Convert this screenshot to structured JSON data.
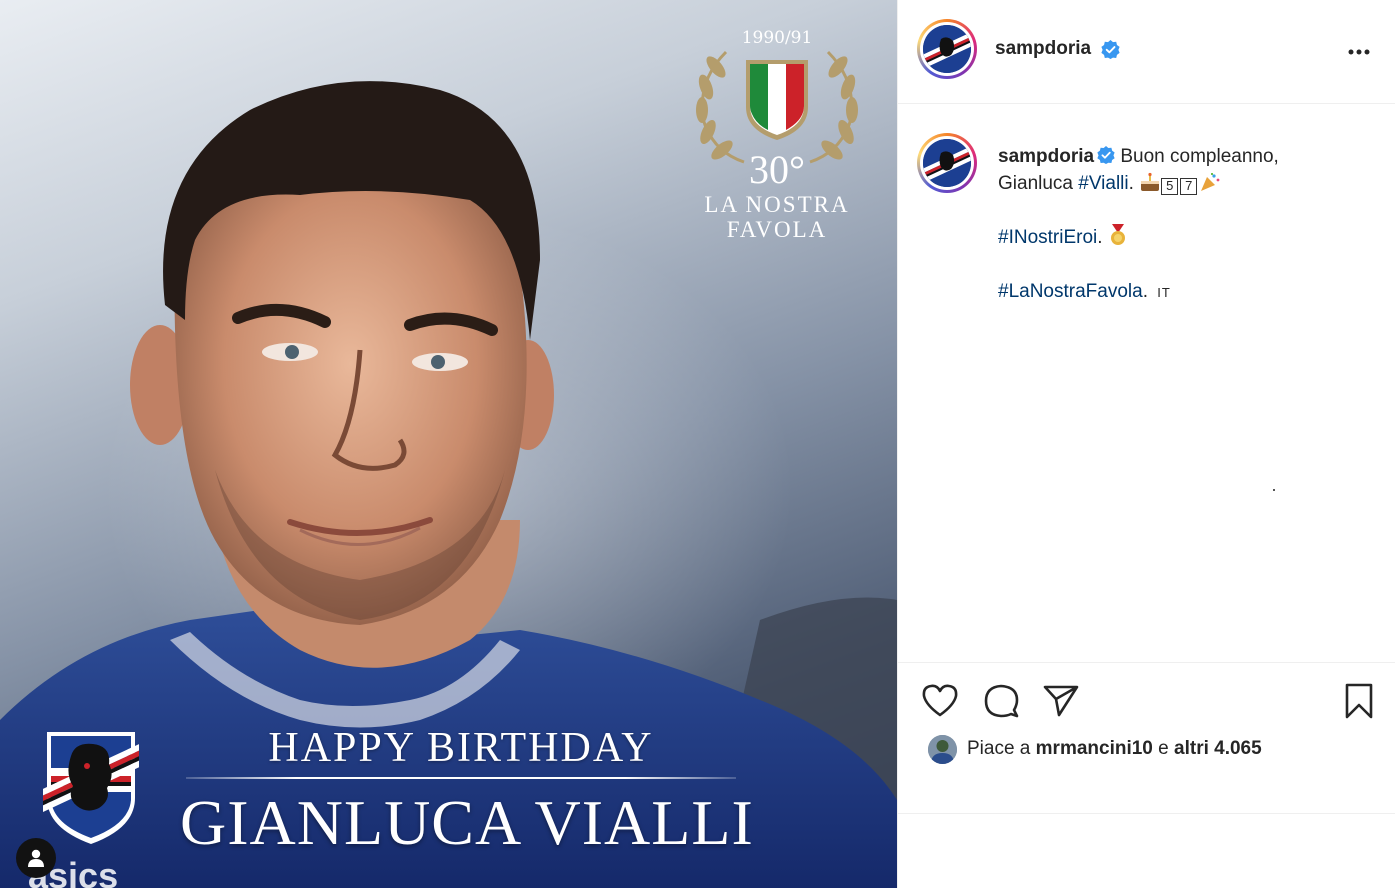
{
  "media": {
    "emblem": {
      "season": "1990/91",
      "anniversary": "30°",
      "tagline_line1": "LA NOSTRA",
      "tagline_line2": "FAVOLA"
    },
    "greeting": "HAPPY BIRTHDAY",
    "player_name": "GIANLUCA VIALLI",
    "tag_button_icon": "user-icon"
  },
  "post": {
    "author": "sampdoria",
    "verified": true,
    "more_icon": "•••"
  },
  "caption": {
    "author": "sampdoria",
    "text_part1": "Buon compleanno, Gianluca ",
    "hashtag1": "#Vialli",
    "text_part2": ". ",
    "digits": [
      "5",
      "7"
    ],
    "hashtag2": "#INostriEroi",
    "hashtag2_suffix": ".",
    "hashtag3": "#LaNostraFavola",
    "hashtag3_suffix": ".",
    "translate_label": "IT"
  },
  "likes": {
    "prefix": "Piace a ",
    "user": "mrmancini10",
    "connector": " e ",
    "others": "altri 4.065"
  },
  "colors": {
    "brand_blue": "#1c3f92",
    "hashtag": "#00376b",
    "verified": "#3897f0"
  }
}
